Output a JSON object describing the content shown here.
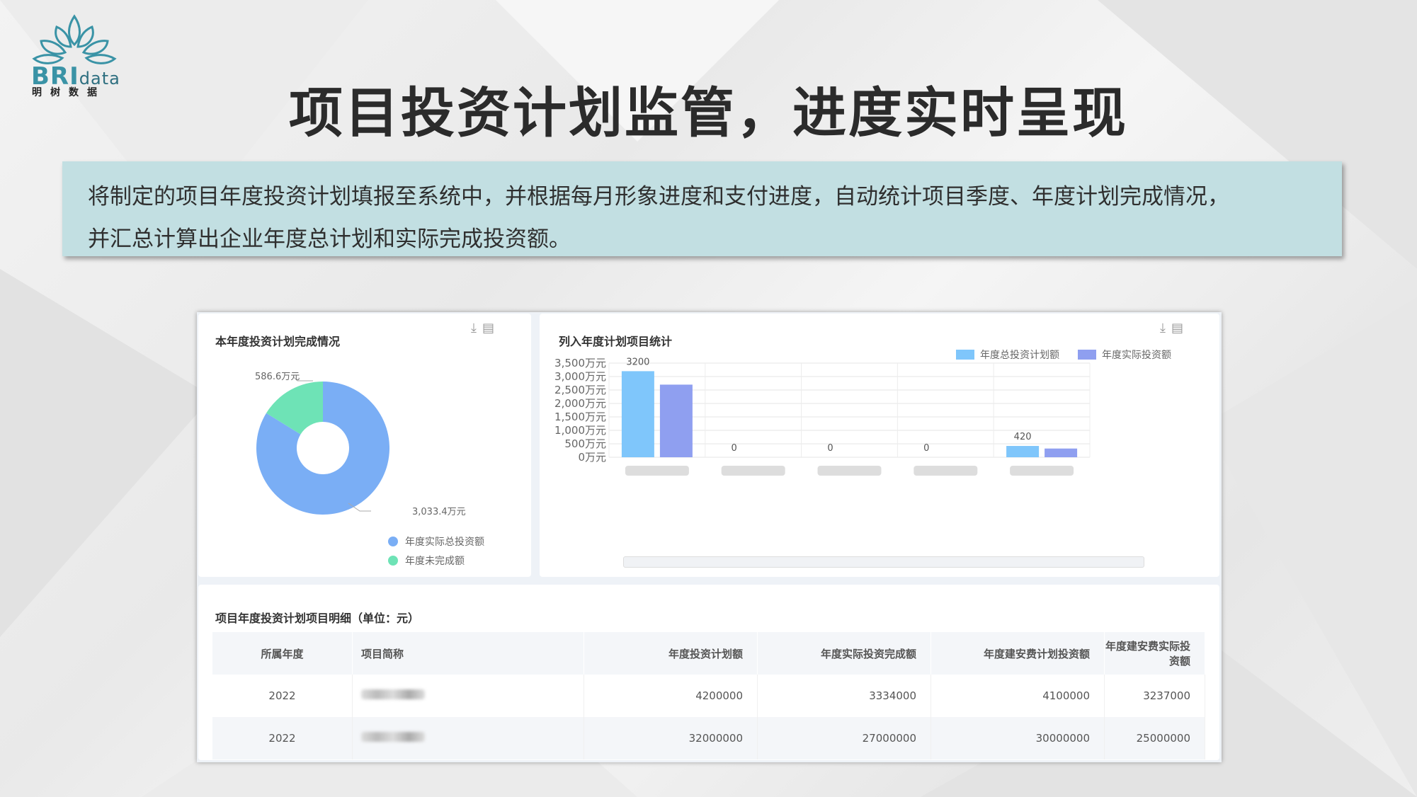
{
  "logo": {
    "brand": "BRI",
    "suffix": "data",
    "subtitle": "明树数据"
  },
  "page_title": "项目投资计划监管，进度实时呈现",
  "description": {
    "line1": "将制定的项目年度投资计划填报至系统中，并根据每月形象进度和支付进度，自动统计项目季度、年度计划完成情况，",
    "line2": "并汇总计算出企业年度总计划和实际完成投资额。"
  },
  "icons": {
    "download": "download-icon",
    "doc": "document-icon"
  },
  "colors": {
    "blue_bar": "#7fc6fb",
    "purple_bar": "#8f9ff0",
    "pie_blue": "#7aaef5",
    "pie_green": "#6ee3b6",
    "desc_bg": "#c2dfe2"
  },
  "donut_panel": {
    "title": "本年度投资计划完成情况",
    "label_small": "586.6万元",
    "label_large": "3,033.4万元",
    "legend": [
      "年度实际总投资额",
      "年度未完成额"
    ]
  },
  "bar_panel": {
    "title": "列入年度计划项目统计",
    "legend": [
      "年度总投资计划额",
      "年度实际投资额"
    ]
  },
  "chart_data": [
    {
      "type": "pie",
      "title": "本年度投资计划完成情况",
      "labels": [
        "年度实际总投资额",
        "年度未完成额"
      ],
      "values": [
        3033.4,
        586.6
      ],
      "unit": "万元",
      "donut": true
    },
    {
      "type": "bar",
      "title": "列入年度计划项目统计",
      "categories": [
        "",
        "",
        "",
        "",
        ""
      ],
      "series": [
        {
          "name": "年度总投资计划额",
          "values": [
            3200,
            0,
            0,
            0,
            420
          ],
          "labels": [
            "3200",
            "0",
            "0",
            "0",
            "420"
          ]
        },
        {
          "name": "年度实际投资额",
          "values": [
            2700,
            0,
            0,
            0,
            324
          ]
        }
      ],
      "ylim": [
        0,
        3500
      ],
      "yticks": [
        "0万元",
        "500万元",
        "1,000万元",
        "1,500万元",
        "2,000万元",
        "2,500万元",
        "3,000万元",
        "3,500万元"
      ],
      "legend": "top-right",
      "grid": true
    }
  ],
  "table": {
    "title": "项目年度投资计划项目明细（单位：元）",
    "headers": [
      "所属年度",
      "项目简称",
      "年度投资计划额",
      "年度实际投资完成额",
      "年度建安费计划投资额",
      "年度建安费实际投资额"
    ],
    "rows": [
      {
        "year": "2022",
        "plan": "4200000",
        "actual": "3334000",
        "build_plan": "4100000",
        "build_actual": "3237000"
      },
      {
        "year": "2022",
        "plan": "32000000",
        "actual": "27000000",
        "build_plan": "30000000",
        "build_actual": "25000000"
      }
    ]
  }
}
